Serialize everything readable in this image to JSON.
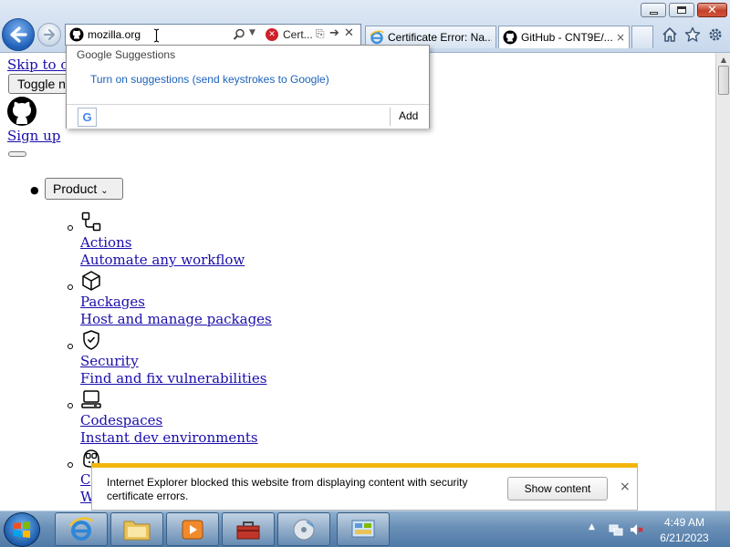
{
  "browser": {
    "address": {
      "value": "mozilla.org",
      "cert_label": "Cert..."
    },
    "tabs": [
      {
        "label": "Certificate Error: Na..."
      },
      {
        "label": "GitHub - CNT9E/..."
      }
    ],
    "close_glyph": "×"
  },
  "suggestions": {
    "header": "Google Suggestions",
    "turn_on": "Turn on suggestions (send keystrokes to Google)",
    "google_icon": "G",
    "add_label": "Add"
  },
  "page": {
    "skip_link": "Skip to co",
    "toggle_label": "Toggle n",
    "signup_link": "Sign up",
    "product_label": "Product",
    "features": [
      {
        "icon": "workflow-icon",
        "title": "Actions",
        "desc": "Automate any workflow"
      },
      {
        "icon": "package-icon",
        "title": "Packages",
        "desc": "Host and manage packages"
      },
      {
        "icon": "shield-check-icon",
        "title": "Security",
        "desc": "Find and fix vulnerabilities"
      },
      {
        "icon": "codespaces-icon",
        "title": "Codespaces",
        "desc": "Instant dev environments"
      },
      {
        "icon": "copilot-icon",
        "title": "C",
        "desc": "W"
      }
    ]
  },
  "notification": {
    "message": "Internet Explorer blocked this website from displaying content with security certificate errors.",
    "button": "Show content",
    "close": "×"
  },
  "taskbar": {
    "time": "4:49 AM",
    "date": "6/21/2023"
  }
}
